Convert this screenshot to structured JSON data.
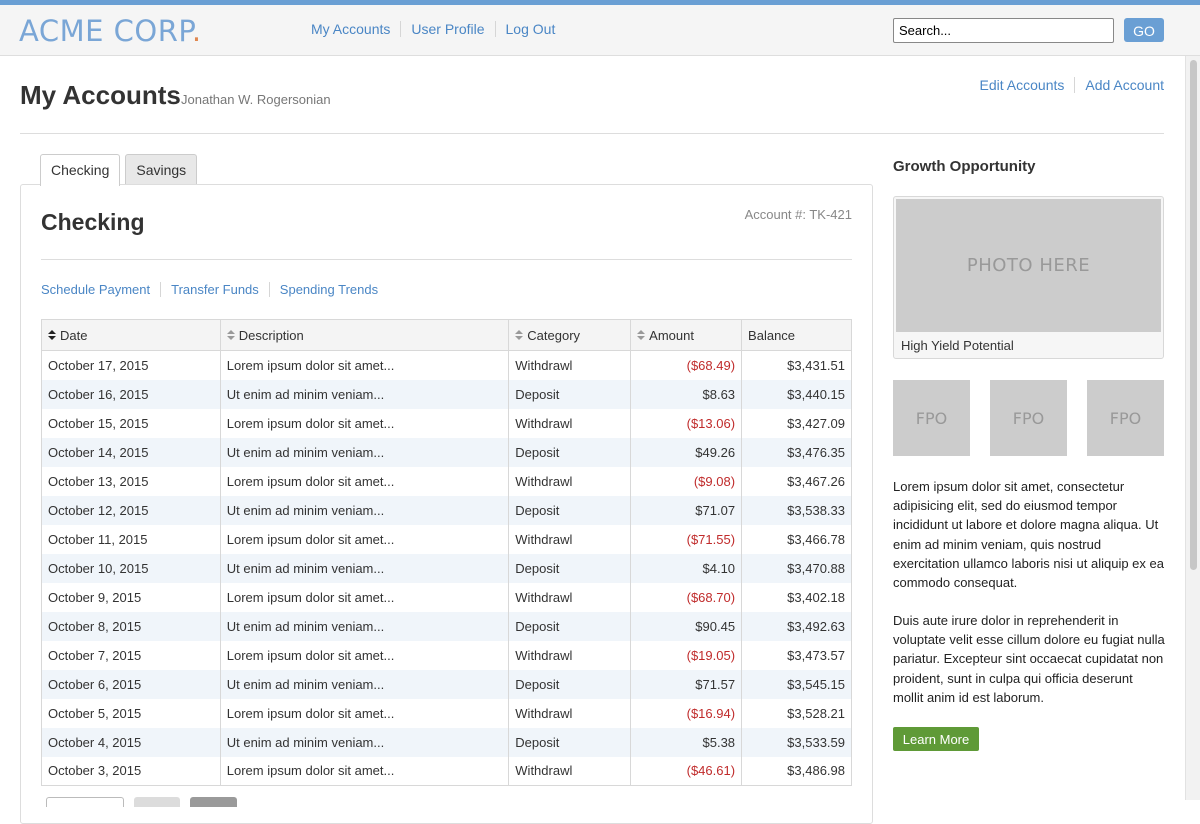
{
  "brand": {
    "logo_text": "ACME CORP",
    "logo_dot": "."
  },
  "nav": {
    "items": [
      "My Accounts",
      "User Profile",
      "Log Out"
    ]
  },
  "search": {
    "placeholder": "Search...",
    "value": "",
    "button_label": "GO"
  },
  "page": {
    "title": "My Accounts",
    "user_name": "Jonathan W. Rogersonian",
    "actions": [
      "Edit Accounts",
      "Add Account"
    ]
  },
  "tabs": [
    {
      "label": "Checking",
      "active": true
    },
    {
      "label": "Savings",
      "active": false
    }
  ],
  "account": {
    "title": "Checking",
    "number_label": "Account #: TK-421",
    "actions": [
      "Schedule Payment",
      "Transfer Funds",
      "Spending Trends"
    ]
  },
  "table": {
    "columns": [
      {
        "label": "Date",
        "sortable": true,
        "sorted": true
      },
      {
        "label": "Description",
        "sortable": true,
        "sorted": false
      },
      {
        "label": "Category",
        "sortable": true,
        "sorted": false
      },
      {
        "label": "Amount",
        "sortable": true,
        "sorted": false
      },
      {
        "label": "Balance",
        "sortable": false,
        "sorted": false
      }
    ],
    "rows": [
      {
        "date": "October 17, 2015",
        "description": "Lorem ipsum dolor sit amet...",
        "category": "Withdrawl",
        "amount": "($68.49)",
        "negative": true,
        "balance": "$3,431.51"
      },
      {
        "date": "October 16, 2015",
        "description": "Ut enim ad minim veniam...",
        "category": "Deposit",
        "amount": "$8.63",
        "negative": false,
        "balance": "$3,440.15"
      },
      {
        "date": "October 15, 2015",
        "description": "Lorem ipsum dolor sit amet...",
        "category": "Withdrawl",
        "amount": "($13.06)",
        "negative": true,
        "balance": "$3,427.09"
      },
      {
        "date": "October 14, 2015",
        "description": "Ut enim ad minim veniam...",
        "category": "Deposit",
        "amount": "$49.26",
        "negative": false,
        "balance": "$3,476.35"
      },
      {
        "date": "October 13, 2015",
        "description": "Lorem ipsum dolor sit amet...",
        "category": "Withdrawl",
        "amount": "($9.08)",
        "negative": true,
        "balance": "$3,467.26"
      },
      {
        "date": "October 12, 2015",
        "description": "Ut enim ad minim veniam...",
        "category": "Deposit",
        "amount": "$71.07",
        "negative": false,
        "balance": "$3,538.33"
      },
      {
        "date": "October 11, 2015",
        "description": "Lorem ipsum dolor sit amet...",
        "category": "Withdrawl",
        "amount": "($71.55)",
        "negative": true,
        "balance": "$3,466.78"
      },
      {
        "date": "October 10, 2015",
        "description": "Ut enim ad minim veniam...",
        "category": "Deposit",
        "amount": "$4.10",
        "negative": false,
        "balance": "$3,470.88"
      },
      {
        "date": "October 9, 2015",
        "description": "Lorem ipsum dolor sit amet...",
        "category": "Withdrawl",
        "amount": "($68.70)",
        "negative": true,
        "balance": "$3,402.18"
      },
      {
        "date": "October 8, 2015",
        "description": "Ut enim ad minim veniam...",
        "category": "Deposit",
        "amount": "$90.45",
        "negative": false,
        "balance": "$3,492.63"
      },
      {
        "date": "October 7, 2015",
        "description": "Lorem ipsum dolor sit amet...",
        "category": "Withdrawl",
        "amount": "($19.05)",
        "negative": true,
        "balance": "$3,473.57"
      },
      {
        "date": "October 6, 2015",
        "description": "Ut enim ad minim veniam...",
        "category": "Deposit",
        "amount": "$71.57",
        "negative": false,
        "balance": "$3,545.15"
      },
      {
        "date": "October 5, 2015",
        "description": "Lorem ipsum dolor sit amet...",
        "category": "Withdrawl",
        "amount": "($16.94)",
        "negative": true,
        "balance": "$3,528.21"
      },
      {
        "date": "October 4, 2015",
        "description": "Ut enim ad minim veniam...",
        "category": "Deposit",
        "amount": "$5.38",
        "negative": false,
        "balance": "$3,533.59"
      },
      {
        "date": "October 3, 2015",
        "description": "Lorem ipsum dolor sit amet...",
        "category": "Withdrawl",
        "amount": "($46.61)",
        "negative": true,
        "balance": "$3,486.98"
      }
    ]
  },
  "sidebar": {
    "heading": "Growth Opportunity",
    "photo_placeholder": "PHOTO HERE",
    "photo_caption": "High Yield Potential",
    "thumbnails": [
      "FPO",
      "FPO",
      "FPO"
    ],
    "paragraphs": [
      "Lorem ipsum dolor sit amet, consectetur adipisicing elit, sed do eiusmod tempor incididunt ut labore et dolore magna aliqua. Ut enim ad minim veniam, quis nostrud exercitation ullamco laboris nisi ut aliquip ex ea commodo consequat.",
      "Duis aute irure dolor in reprehenderit in voluptate velit esse cillum dolore eu fugiat nulla pariatur. Excepteur sint occaecat cupidatat non proident, sunt in culpa qui officia deserunt mollit anim id est laborum."
    ],
    "cta_label": "Learn More"
  },
  "colors": {
    "accent": "#6a9fd4",
    "link": "#4a86c5",
    "negative_amount": "#c02b2b",
    "cta": "#5f9a37",
    "logo_dot": "#e0874f"
  }
}
